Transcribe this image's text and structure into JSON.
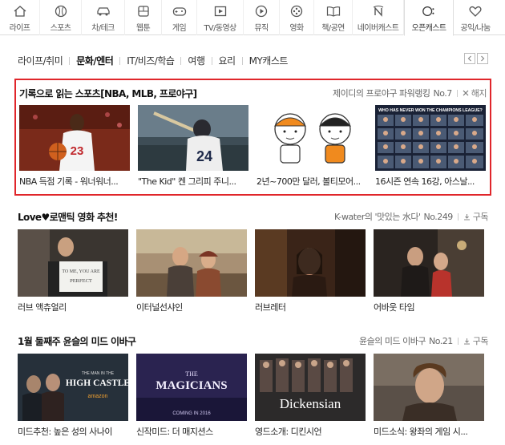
{
  "nav": [
    {
      "label": "라이프",
      "icon": "home-icon"
    },
    {
      "label": "스포츠",
      "icon": "baseball-icon"
    },
    {
      "label": "차/테크",
      "icon": "car-icon"
    },
    {
      "label": "웹툰",
      "icon": "webtoon-icon"
    },
    {
      "label": "게임",
      "icon": "gamepad-icon"
    },
    {
      "label": "TV/동영상",
      "icon": "video-icon"
    },
    {
      "label": "뮤직",
      "icon": "music-icon"
    },
    {
      "label": "영화",
      "icon": "film-reel-icon"
    },
    {
      "label": "책/공연",
      "icon": "book-icon"
    },
    {
      "label": "네이버캐스트",
      "icon": "naver-n-icon"
    },
    {
      "label": "오픈캐스트",
      "icon": "opencast-icon"
    },
    {
      "label": "공익/나눔",
      "icon": "heart-icon"
    }
  ],
  "subtabs": [
    "라이프/취미",
    "문화/엔터",
    "IT/비즈/학습",
    "여행",
    "요리",
    "MY캐스트"
  ],
  "active_subtab": 1,
  "sections": [
    {
      "title": "기록으로 읽는 스포츠[NBA, MLB, 프로야구]",
      "source": "제이디의 프로야구 파워랭킹",
      "number": "No.7",
      "action": "해지",
      "cards": [
        "NBA 득점 기록 - 워너워너...",
        "\"The Kid\" 켄 그리피 주니...",
        "2년~700만 달러, 볼티모어...",
        "16시즌 연속 16강, 아스날..."
      ]
    },
    {
      "title": "Love♥로맨틱 영화 추천!",
      "source": "K-water의 '맛있는 水다'",
      "number": "No.249",
      "action": "구독",
      "cards": [
        "러브 액츄얼리",
        "이터널선샤인",
        "러브레터",
        "어바웃 타임"
      ]
    },
    {
      "title": "1월 둘째주 윤슬의 미드 이바구",
      "source": "윤슬의 미드 이바구",
      "number": "No.21",
      "action": "구독",
      "cards": [
        "미드추천: 높은 성의 사나이",
        "신작미드: 더 매지션스",
        "영드소개: 디킨시언",
        "미드소식: 왕좌의 게임 시..."
      ]
    }
  ],
  "thumb_text": {
    "love_sign_1": "TO ME, YOU ARE",
    "love_sign_2": "PERFECT",
    "castle_1": "THE MAN IN THE",
    "castle_2": "HIGH CASTLE",
    "castle_3": "amazon",
    "magicians_1": "THE",
    "magicians_2": "MAGICIANS",
    "magicians_3": "COMING IN 2016",
    "dickensian": "Dickensian",
    "sign_24": "24",
    "sign_23": "23",
    "champions": "WHO HAS NEVER WON THE CHAMPIONS LEAGUE?"
  },
  "colors": {
    "highlight": "#e0262b",
    "accent": "#111"
  }
}
